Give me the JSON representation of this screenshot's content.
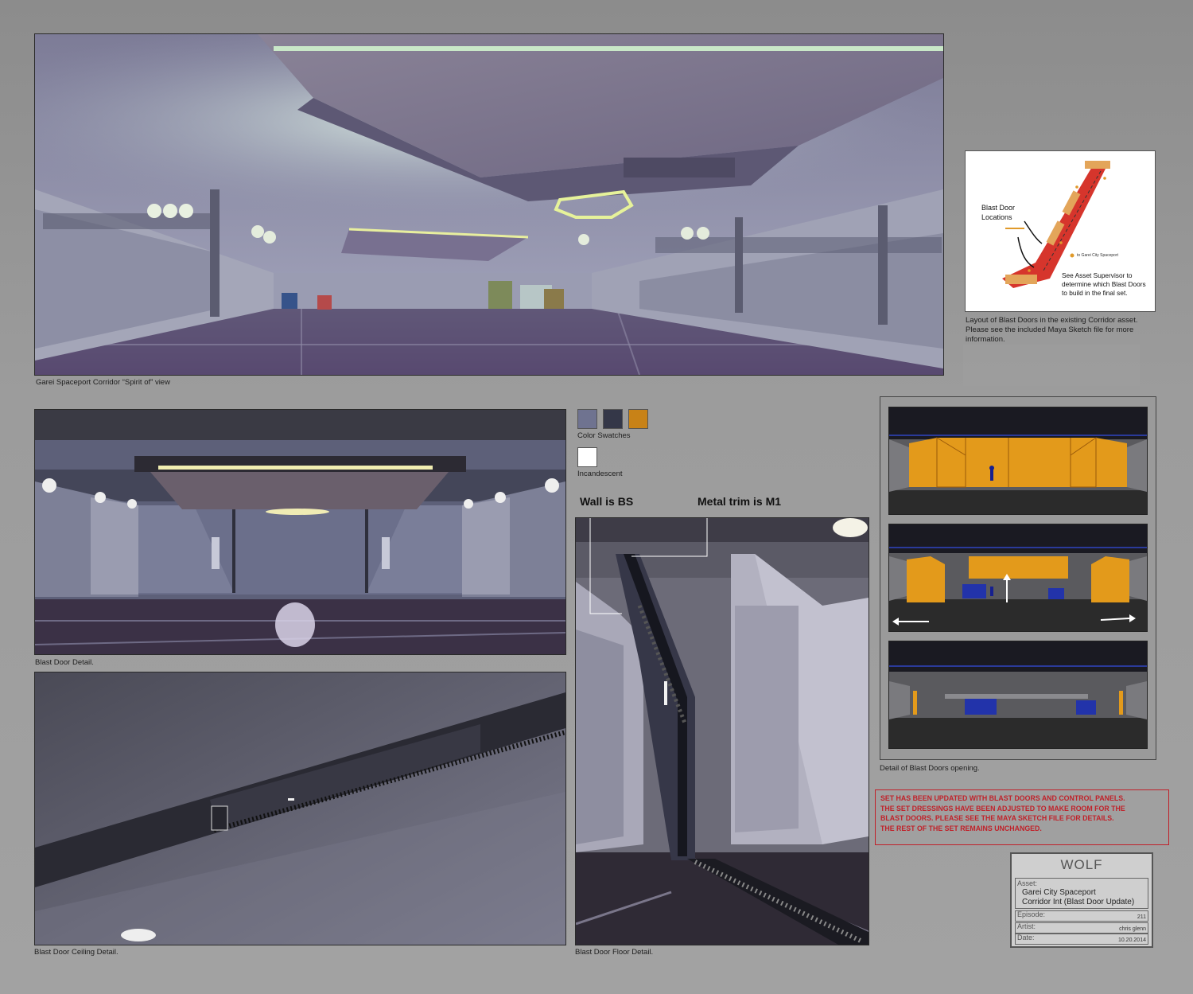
{
  "main_render": {
    "caption": "Garei Spaceport Corridor “Spirit of” view"
  },
  "layout_inset": {
    "label_blast_door": "Blast Door",
    "label_locations": "Locations",
    "label_destination": "to Garei City Spaceport",
    "note_line1": "See Asset Supervisor to",
    "note_line2": "determine which Blast Doors",
    "note_line3": "to build in the final set.",
    "caption_line1": "Layout of Blast Doors in the existing Corridor asset.",
    "caption_line2": "Please see the included Maya Sketch file for more",
    "caption_line3": "information."
  },
  "blast_door_detail": {
    "caption": "Blast Door Detail."
  },
  "swatches": {
    "label": "Color Swatches",
    "colors": [
      "#6f7390",
      "#343748",
      "#c88217"
    ],
    "incandescent_color": "#ffffff",
    "incandescent_label": "Incandescent"
  },
  "floor_detail": {
    "callout_wall": "Wall is BS",
    "callout_trim": "Metal trim is M1",
    "caption": "Blast Door Floor Detail."
  },
  "ceiling_detail": {
    "caption": "Blast Door Ceiling Detail."
  },
  "opening_sequence": {
    "caption": "Detail of Blast Doors opening.",
    "door_color": "#e39a1b"
  },
  "notice": {
    "line1": "SET HAS BEEN UPDATED WITH BLAST DOORS AND CONTROL PANELS.",
    "line2": "THE SET DRESSINGS HAVE BEEN ADJUSTED TO MAKE ROOM FOR THE",
    "line3": "BLAST DOORS. PLEASE SEE THE MAYA SKETCH FILE FOR DETAILS.",
    "line4": "THE REST OF THE SET REMAINS UNCHANGED."
  },
  "title_block": {
    "studio": "WOLF",
    "asset_label": "Asset:",
    "asset_line1": "Garei City Spaceport",
    "asset_line2": "Corridor Int (Blast Door Update)",
    "episode_label": "Episode:",
    "episode": "211",
    "artist_label": "Artist:",
    "artist": "chris glenn",
    "date_label": "Date:",
    "date": "10.20.2014"
  }
}
